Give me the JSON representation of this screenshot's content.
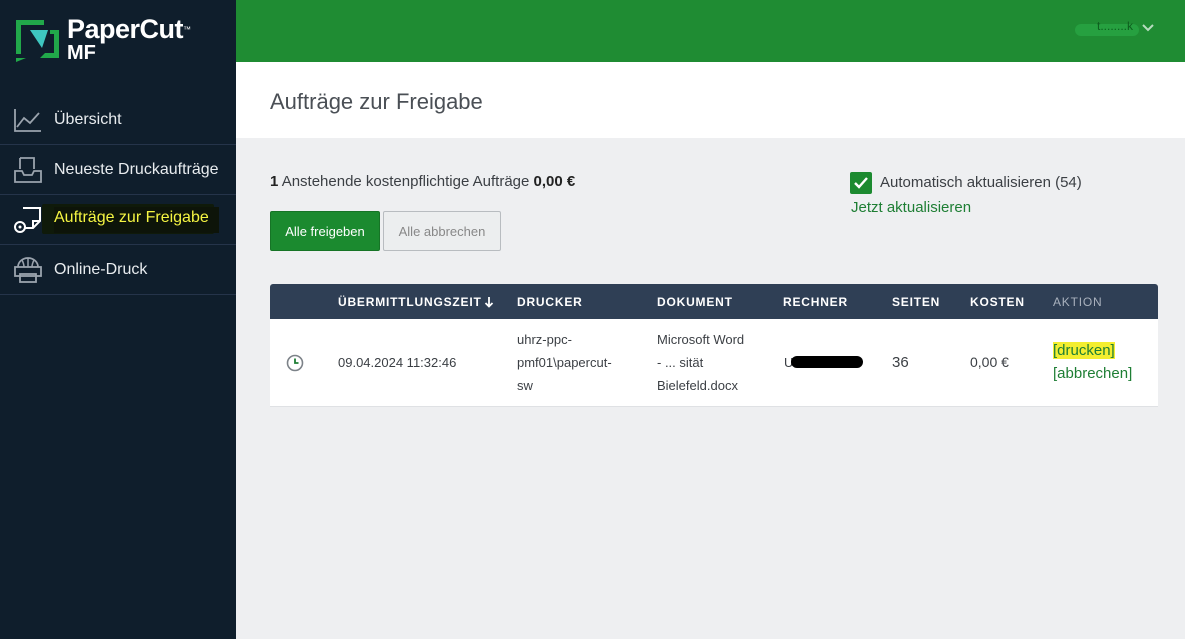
{
  "app": {
    "logo_text": "PaperCut",
    "logo_tm": "™",
    "logo_sub": "MF",
    "accent_color": "#1f8c33",
    "sidebar_color": "#0f1e2c"
  },
  "sidebar": {
    "items": [
      {
        "label": "Übersicht",
        "icon": "line-chart-icon"
      },
      {
        "label": "Neueste Druckaufträge",
        "icon": "printer-tray-icon"
      },
      {
        "label": "Aufträge zur Freigabe",
        "icon": "release-print-icon",
        "active": true
      },
      {
        "label": "Online-Druck",
        "icon": "web-print-icon"
      }
    ]
  },
  "topbar": {
    "user_name": "t........k"
  },
  "page": {
    "title": "Aufträge zur Freigabe"
  },
  "summary": {
    "count": "1",
    "text": "Anstehende kostenpflichtige Aufträge",
    "amount": "0,00 €"
  },
  "buttons": {
    "release_all": "Alle freigeben",
    "cancel_all": "Alle abbrechen"
  },
  "auto_refresh": {
    "checked": true,
    "label": "Automatisch aktualisieren (54)",
    "refresh_now": "Jetzt aktualisieren"
  },
  "table": {
    "headers": {
      "time": "ÜBERMITTLUNGSZEIT",
      "printer": "DRUCKER",
      "document": "DOKUMENT",
      "computer": "RECHNER",
      "pages": "SEITEN",
      "cost": "KOSTEN",
      "action": "AKTION"
    },
    "rows": [
      {
        "time": "09.04.2024 11:32:46",
        "printer_lines": [
          "uhrz-ppc-",
          "pmf01\\papercut-",
          "sw"
        ],
        "document_lines": [
          "Microsoft Word",
          "- ... sität",
          "Bielefeld.docx"
        ],
        "computer_prefix": "U",
        "pages": "36",
        "cost": "0,00 €",
        "action_print": "drucken",
        "action_cancel": "abbrechen"
      }
    ]
  }
}
